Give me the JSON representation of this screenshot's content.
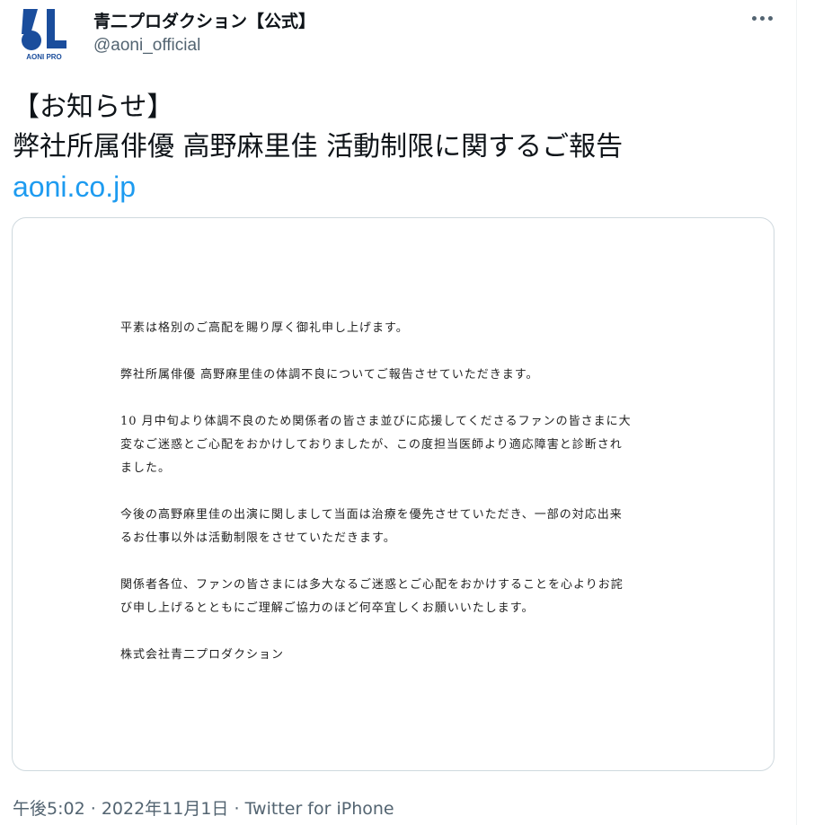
{
  "tweet": {
    "author": {
      "display_name": "青二プロダクション【公式】",
      "handle": "@aoni_official",
      "avatar_logo_text": "AONI PRO",
      "avatar_icon": "aoni-pro-logo"
    },
    "more_icon": "more-dots-icon",
    "text_lines": [
      "【お知らせ】",
      "弊社所属俳優 高野麻里佳 活動制限に関するご報告"
    ],
    "link_text": "aoni.co.jp",
    "document": {
      "paragraphs": [
        [
          "平素は格別のご高配を賜り厚く御礼申し上げます。"
        ],
        [
          "弊社所属俳優 高野麻里佳の体調不良についてご報告させていただきます。"
        ],
        [
          "10 月中旬より体調不良のため関係者の皆さま並びに応援してくださるファンの皆さまに大",
          "変なご迷惑とご心配をおかけしておりましたが、この度担当医師より適応障害と診断され",
          "ました。"
        ],
        [
          "今後の高野麻里佳の出演に関しまして当面は治療を優先させていただき、一部の対応出来",
          "るお仕事以外は活動制限をさせていただきます。"
        ],
        [
          "関係者各位、ファンの皆さまには多大なるご迷惑とご心配をおかけすることを心よりお詫",
          "び申し上げるとともにご理解ご協力のほど何卒宜しくお願いいたします。"
        ],
        [
          "株式会社青二プロダクション"
        ]
      ]
    },
    "meta": {
      "time": "午後5:02",
      "separator": "·",
      "date": "2022年11月1日",
      "source": "Twitter for iPhone"
    }
  },
  "colors": {
    "text": "#0f1419",
    "secondary": "#536471",
    "link": "#1d9bf0",
    "border": "#cfd9de",
    "logo_blue": "#1a4d9c"
  }
}
